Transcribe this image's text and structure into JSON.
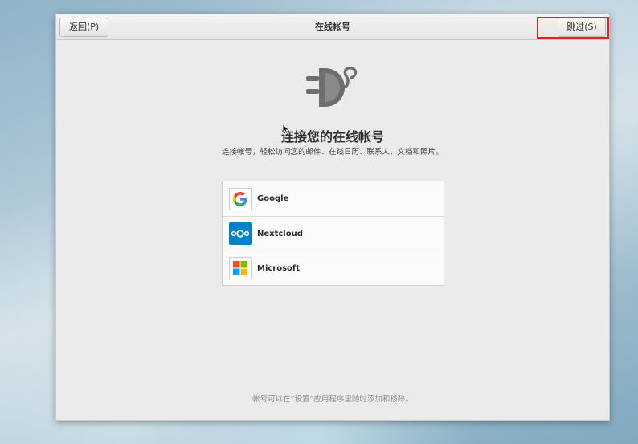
{
  "window": {
    "title": "在线帐号",
    "back_label": "返回(P)",
    "skip_label": "跳过(S)"
  },
  "main": {
    "heading": "连接您的在线帐号",
    "description": "连接帐号，轻松访问您的邮件、在线日历、联系人、文档和照片。",
    "providers": [
      {
        "name": "Google",
        "icon": "google-icon"
      },
      {
        "name": "Nextcloud",
        "icon": "nextcloud-icon"
      },
      {
        "name": "Microsoft",
        "icon": "microsoft-icon"
      }
    ],
    "footer_note": "帐号可以在“设置”应用程序里随时添加和移除。"
  },
  "colors": {
    "highlight": "#e8201f",
    "nextcloud": "#0082c9"
  }
}
